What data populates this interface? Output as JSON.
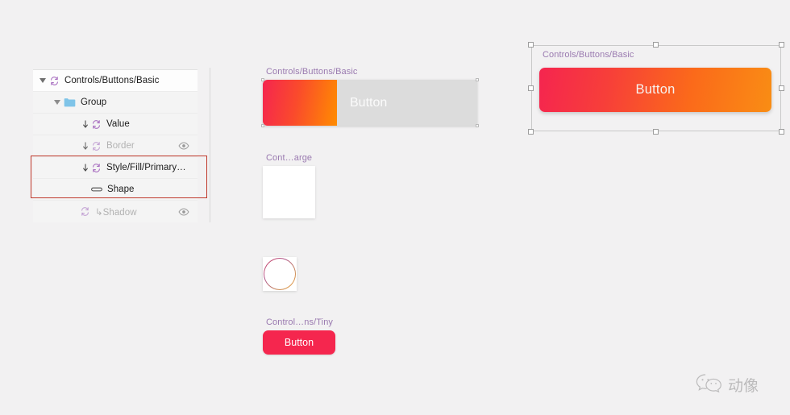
{
  "app": {
    "background_color": "#f2f1f2"
  },
  "layer_panel": {
    "rows": [
      {
        "label": "Controls/Buttons/Basic",
        "icon": "symbol-icon",
        "depth": 0,
        "disclosure": "expanded",
        "dim": false,
        "has_override_arrow": false,
        "eye": false,
        "shaded": false
      },
      {
        "label": "Group",
        "icon": "folder-icon",
        "depth": 1,
        "disclosure": "expanded",
        "dim": false,
        "has_override_arrow": false,
        "eye": false,
        "shaded": true
      },
      {
        "label": "Value",
        "icon": "symbol-icon",
        "depth": 2,
        "disclosure": "none",
        "dim": false,
        "has_override_arrow": true,
        "eye": false,
        "shaded": true
      },
      {
        "label": "Border",
        "icon": "symbol-icon",
        "depth": 2,
        "disclosure": "none",
        "dim": true,
        "has_override_arrow": true,
        "eye": true,
        "shaded": true
      },
      {
        "label": "Style/Fill/Primary…",
        "icon": "symbol-icon",
        "depth": 2,
        "disclosure": "none",
        "dim": false,
        "has_override_arrow": true,
        "eye": false,
        "shaded": true
      },
      {
        "label": "Shape",
        "icon": "rounded-rect-icon",
        "depth": 2,
        "disclosure": "none",
        "dim": false,
        "has_override_arrow": false,
        "eye": false,
        "shaded": true
      },
      {
        "label": "↳Shadow",
        "icon": "symbol-icon",
        "depth": 2,
        "disclosure": "none",
        "dim": true,
        "has_override_arrow": false,
        "eye": true,
        "shaded": true
      }
    ],
    "annotation": {
      "color": "#c0392b",
      "covers": [
        "Style/Fill/Primary…",
        "Shape"
      ]
    }
  },
  "canvas": {
    "artboards": [
      {
        "name": "controls-buttons-basic-preview",
        "label": "Controls/Buttons/Basic"
      },
      {
        "name": "cont-arge-preview",
        "label": "Cont…arge"
      },
      {
        "name": "control-ns-tiny-preview",
        "label": "Control…ns/Tiny"
      },
      {
        "name": "controls-buttons-basic-selected",
        "label": "Controls/Buttons/Basic"
      }
    ],
    "label_color": "#9a7ab0",
    "composite_button": {
      "gradient_label": "",
      "gray_label": "Button",
      "gradient_start": "#f5254f",
      "gradient_end": "#ff8c00",
      "gray_color": "#dcdcdc"
    },
    "white_square": {
      "fill": "#ffffff"
    },
    "circle_swatch": {
      "stroke_start": "#d2455f",
      "stroke_end": "#f0a640",
      "fill": "#ffffff"
    },
    "tiny_button": {
      "label": "Button",
      "fill": "#f5264e",
      "text_color": "#ffffff"
    },
    "selected_button": {
      "label": "Button",
      "gradient_start": "#f5254f",
      "gradient_end": "#f98d14",
      "text_color": "#f7f2ef"
    }
  },
  "watermark": {
    "text": "动像",
    "icon": "wechat-icon"
  }
}
